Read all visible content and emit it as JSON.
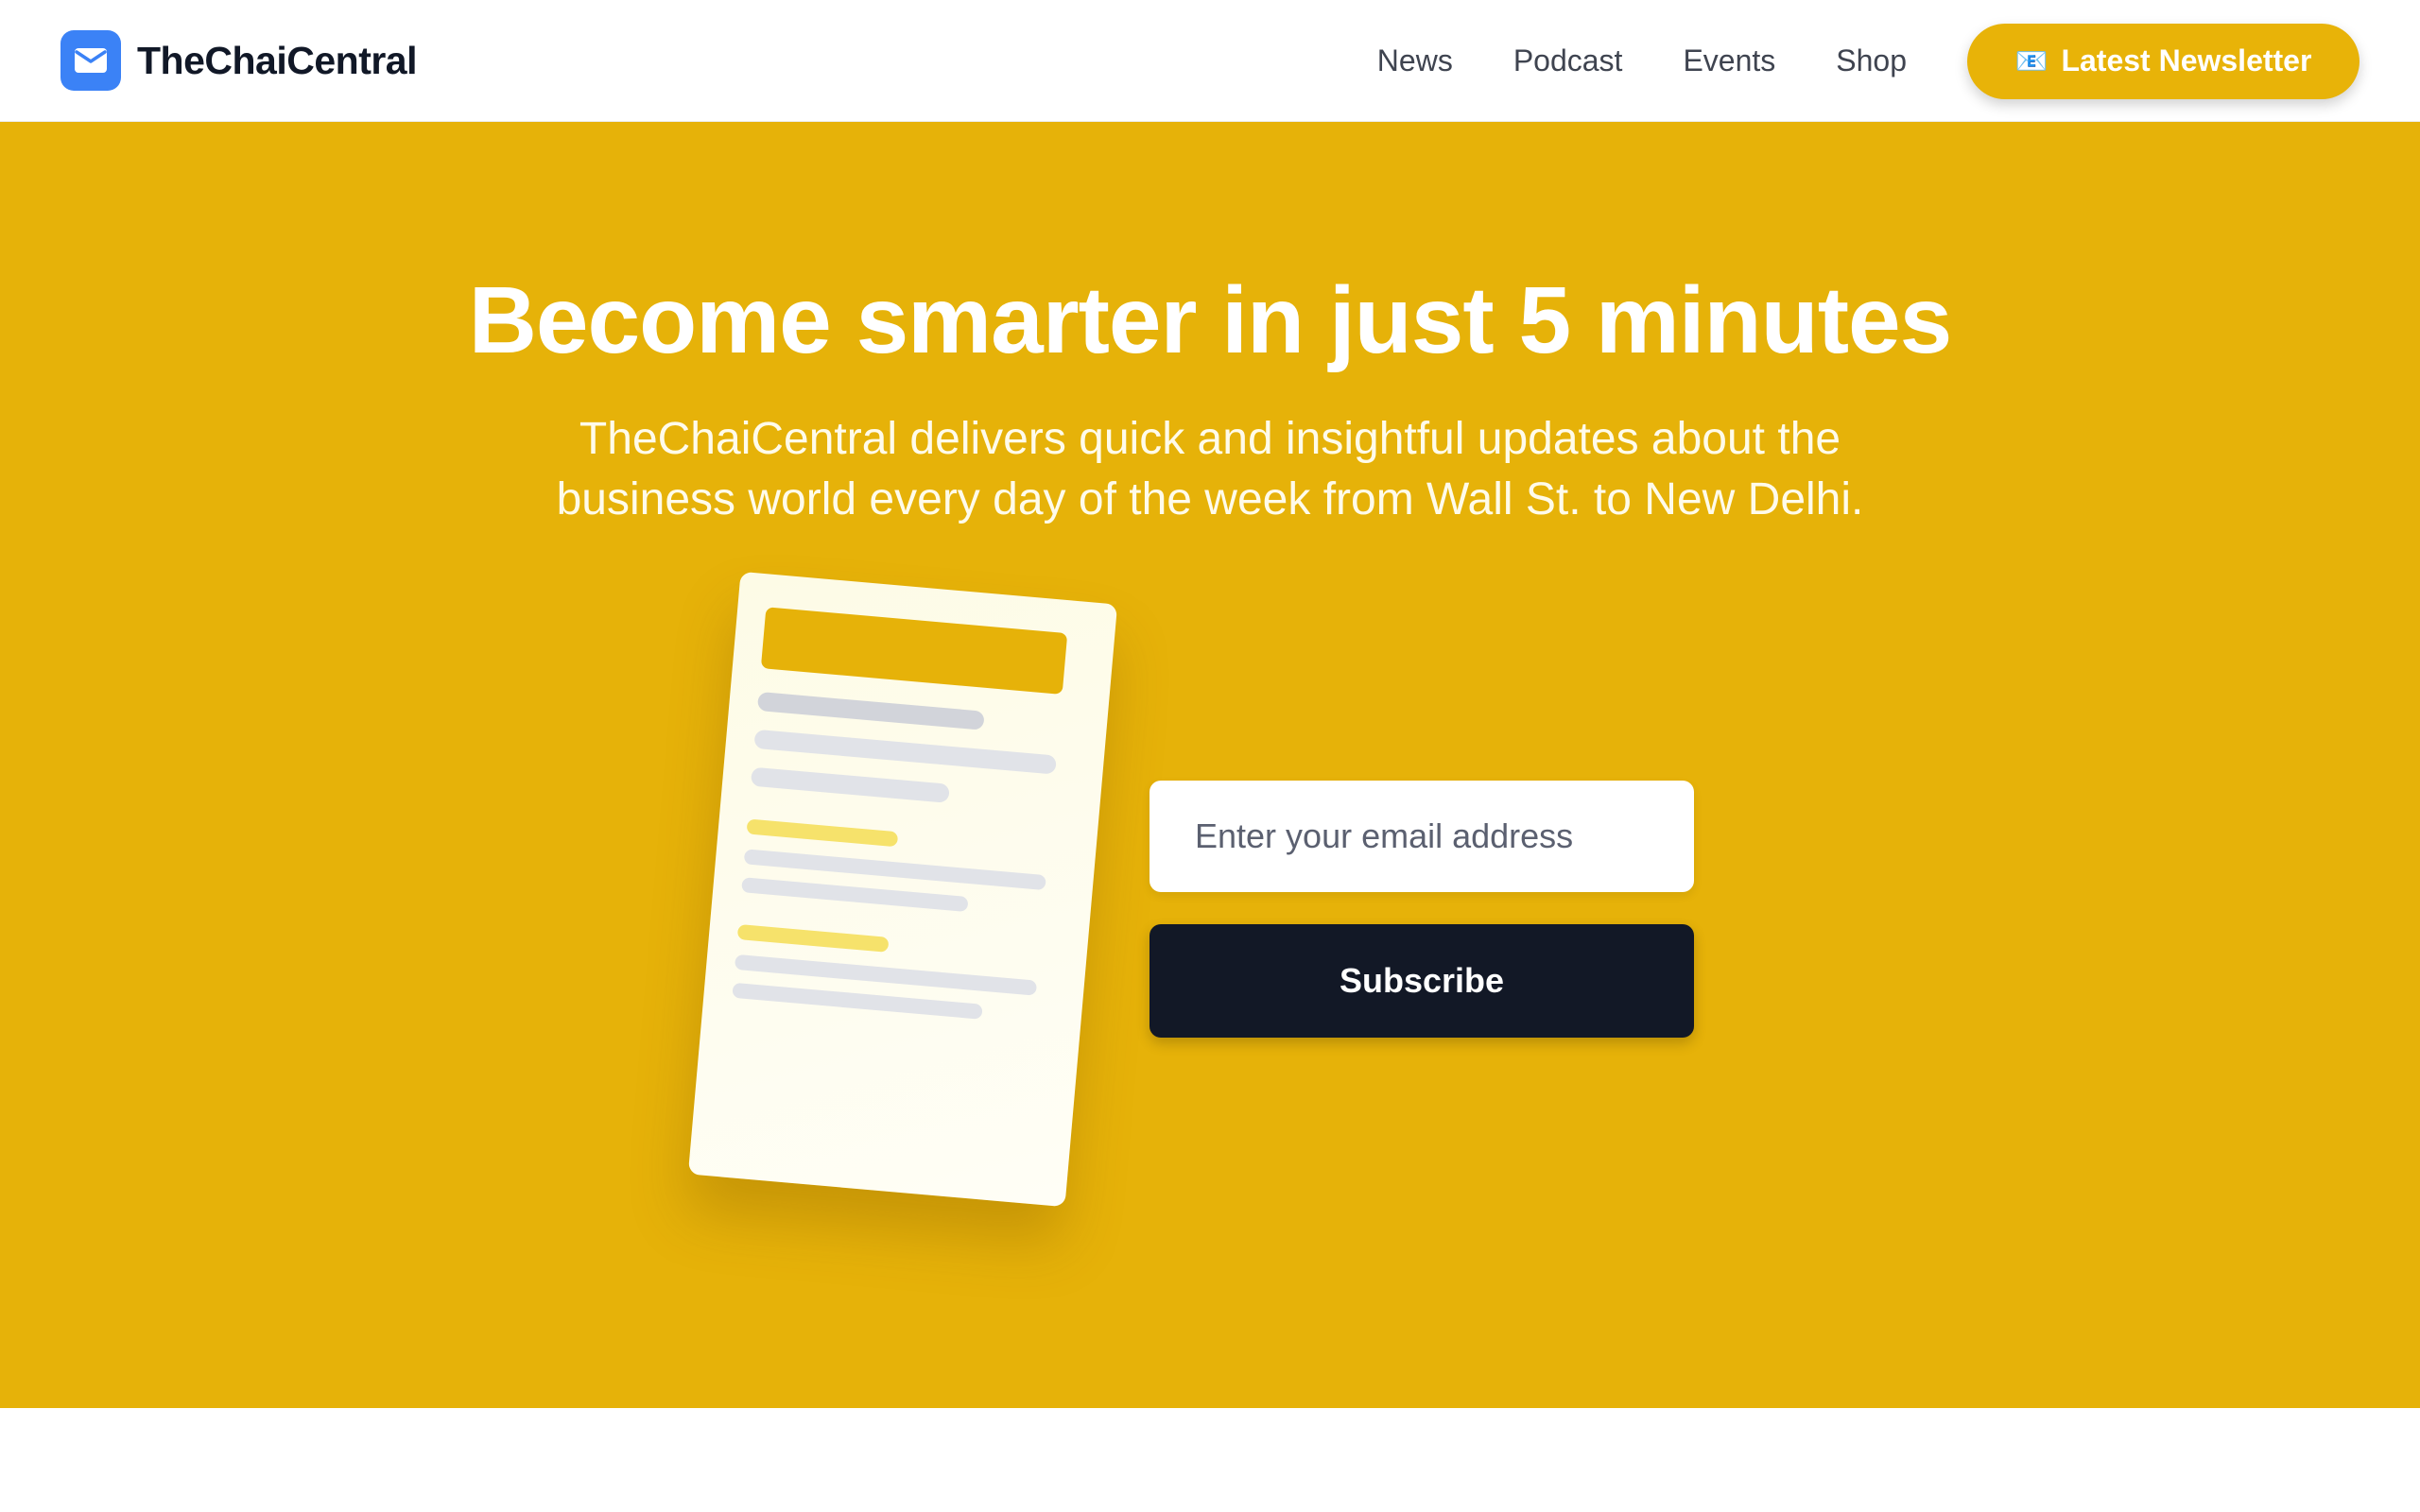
{
  "brand": {
    "name": "TheChaiCentral",
    "icon": "mail-icon",
    "icon_color": "#3b82f6"
  },
  "nav": {
    "items": [
      {
        "label": "News"
      },
      {
        "label": "Podcast"
      },
      {
        "label": "Events"
      },
      {
        "label": "Shop"
      }
    ],
    "cta": {
      "label": "Latest Newsletter",
      "icon": "newspaper-icon",
      "icon_glyph": "📧"
    }
  },
  "hero": {
    "title": "Become smarter in just 5 minutes",
    "subtitle": "TheChaiCentral delivers quick and insightful updates about the business world every day of the week from Wall St. to New Delhi.",
    "background_color": "#e6b209"
  },
  "signup": {
    "email_placeholder": "Enter your email address",
    "email_value": "",
    "subscribe_label": "Subscribe",
    "button_color": "#121826"
  }
}
